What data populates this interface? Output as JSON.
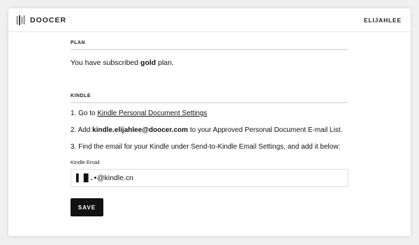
{
  "header": {
    "brand": "DOOCER",
    "user": "ELIJAHLEE"
  },
  "plan": {
    "title": "PLAN",
    "prefix": "You have subscribed ",
    "plan_name": "gold",
    "suffix": " plan."
  },
  "kindle": {
    "title": "KINDLE",
    "step1_prefix": "1. Go to ",
    "step1_link": "Kindle Personal Document Settings",
    "step2_prefix": "2. Add ",
    "step2_email": "kindle.elijahlee@doocer.com",
    "step2_suffix": " to your Approved Personal Document E-mail List.",
    "step3": "3. Find the email for your Kindle under Send-to-Kindle Email Settings, and add it below:",
    "email_label": "Kindle Email",
    "email_masked": "▌▐▌. •",
    "email_value": "@kindle.cn",
    "save_label": "SAVE"
  }
}
